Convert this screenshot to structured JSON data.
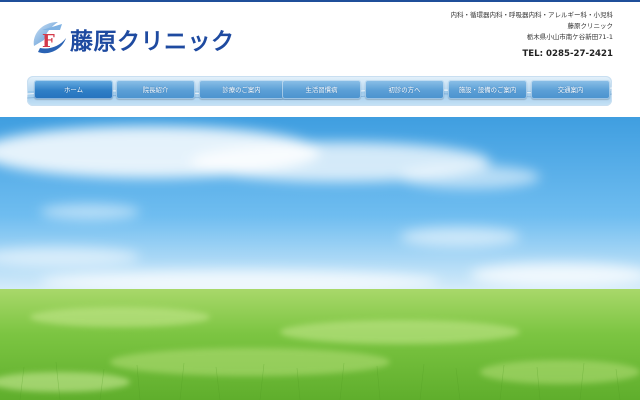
{
  "header": {
    "logo_text": "藤原クリニック",
    "logo_mark_letter": "F",
    "departments": "内科・循環器内科・呼吸器内科・アレルギー科・小児科",
    "clinic_name": "藤原クリニック",
    "address": "栃木県小山市南ケ谷新田71-1",
    "tel": "TEL: 0285-27-2421"
  },
  "nav": {
    "items": [
      {
        "label": "ホーム",
        "active": true
      },
      {
        "label": "院長紹介",
        "active": false
      },
      {
        "label": "診療のご案内",
        "active": false
      },
      {
        "label": "生活習慣病",
        "active": false
      },
      {
        "label": "初診の方へ",
        "active": false
      },
      {
        "label": "施設・設備のご案内",
        "active": false
      },
      {
        "label": "交通案内",
        "active": false
      }
    ]
  },
  "colors": {
    "brand": "#1e4aa0",
    "nav_button": "#5b9fd6",
    "nav_active": "#2f7fc6",
    "sky": "#4fa9e6",
    "grass": "#7cc542"
  }
}
